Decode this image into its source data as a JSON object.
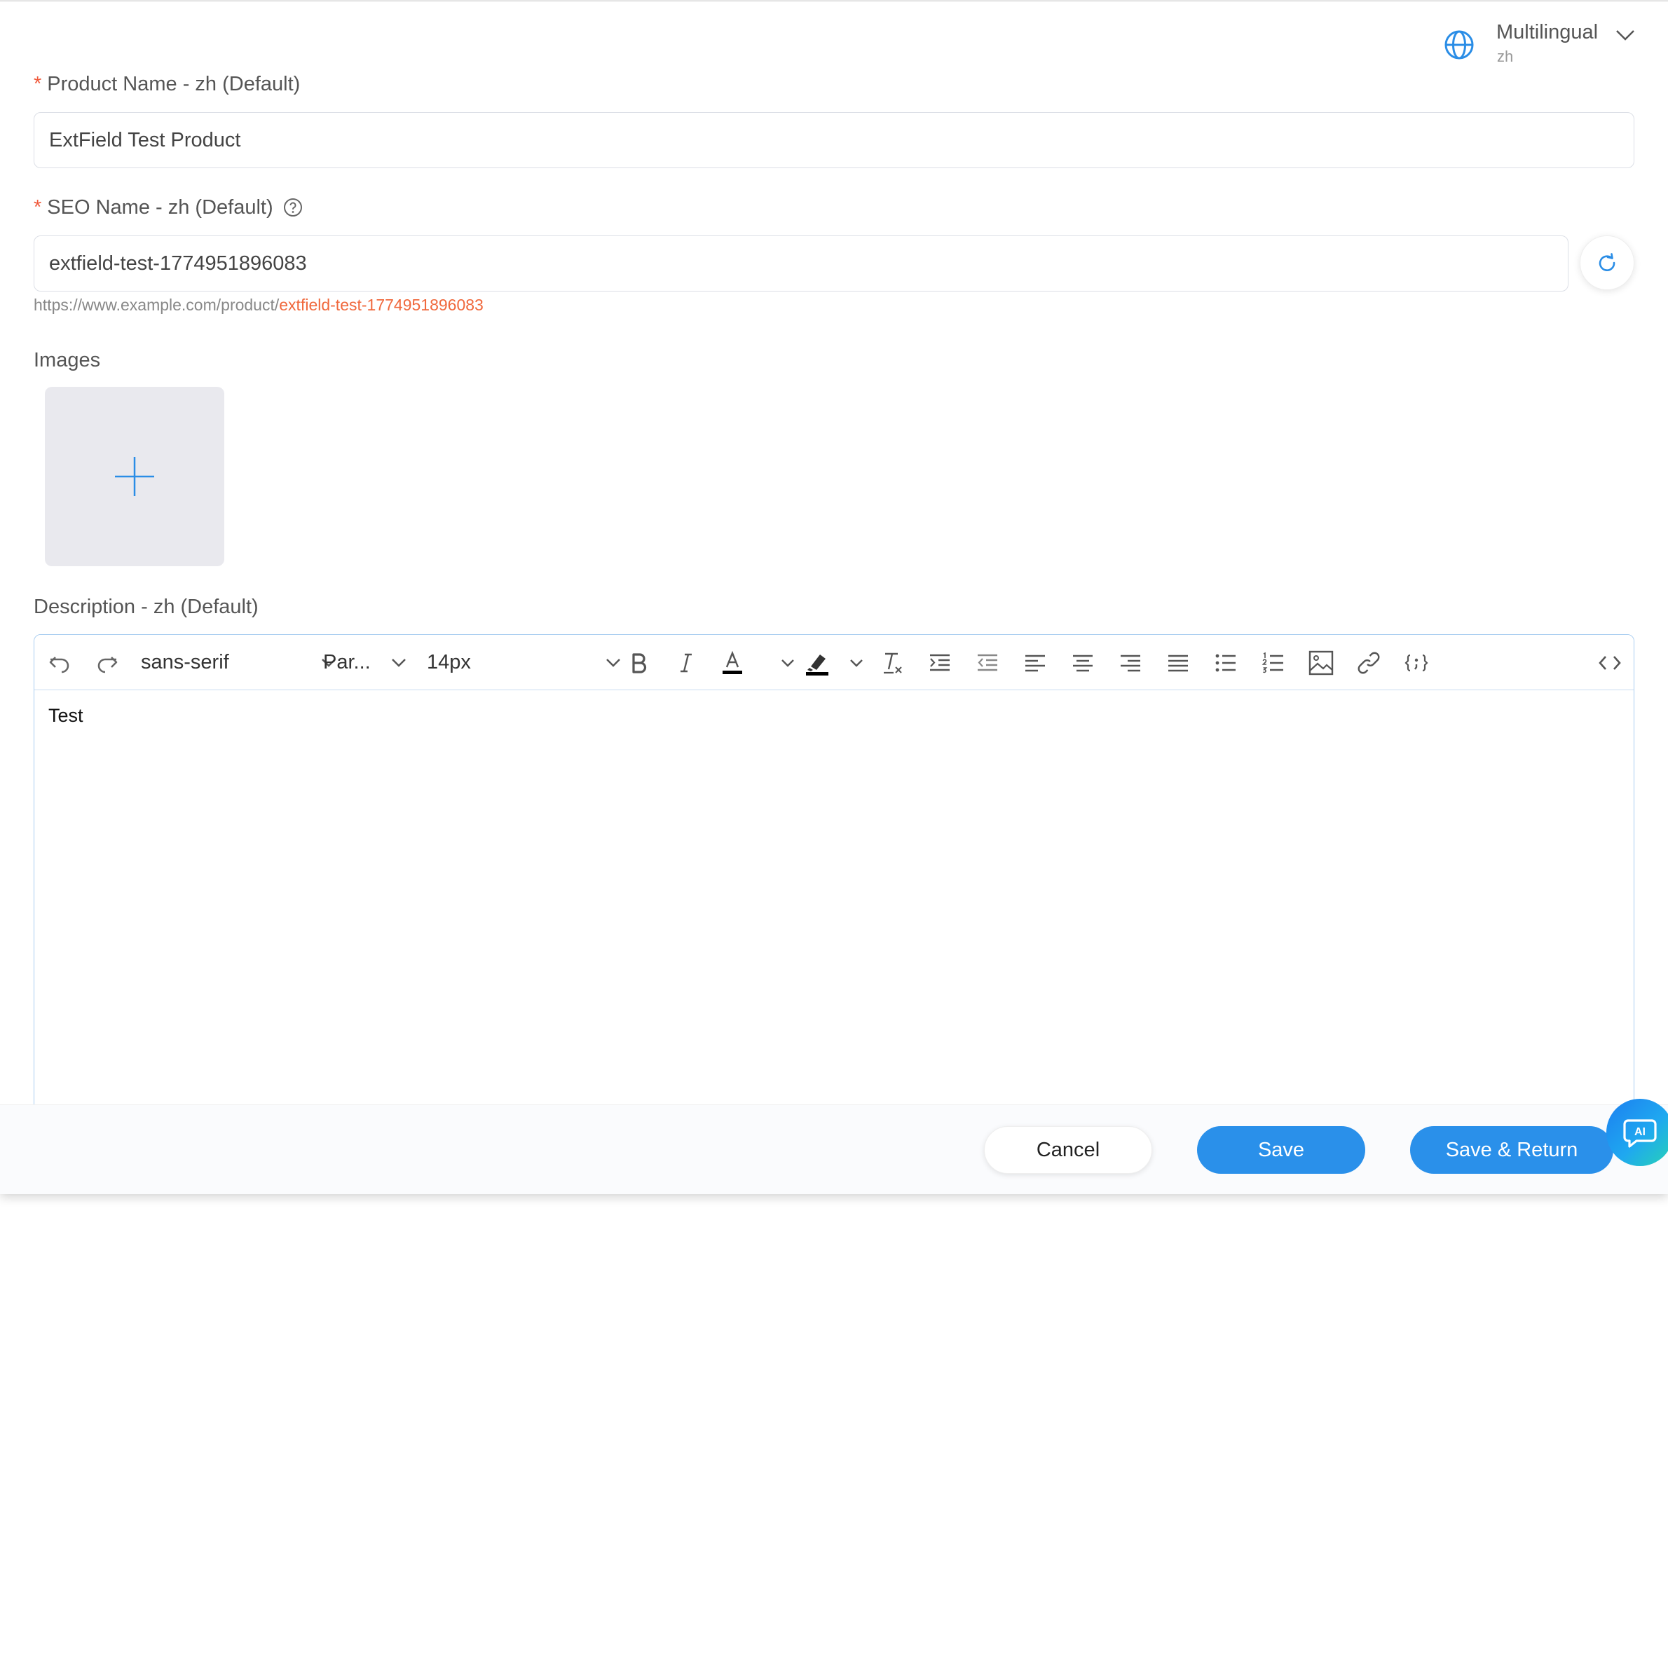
{
  "language": {
    "title": "Multilingual",
    "current": "zh"
  },
  "form": {
    "product_name": {
      "label": "Product Name - zh (Default)",
      "value": "ExtField Test Product"
    },
    "seo_name": {
      "label": "SEO Name - zh (Default)",
      "value": "extfield-test-1774951896083",
      "url_prefix": "https://www.example.com/product/",
      "url_slug": "extfield-test-1774951896083"
    },
    "images": {
      "label": "Images"
    },
    "description": {
      "label": "Description - zh (Default)",
      "content": "Test"
    }
  },
  "editor": {
    "font_family": "sans-serif",
    "block_format": "Par...",
    "font_size": "14px"
  },
  "footer": {
    "cancel_label": "Cancel",
    "save_label": "Save",
    "save_return_label": "Save & Return"
  },
  "ai": {
    "label": "AI"
  },
  "colors": {
    "primary": "#2a90ea",
    "required": "#f05a3c",
    "slug": "#f0683c",
    "editor_border": "#a8cdf0"
  },
  "icons": [
    "globe-icon",
    "chevron-down-icon",
    "help-circle-icon",
    "refresh-icon",
    "plus-icon",
    "undo-icon",
    "redo-icon",
    "bold-icon",
    "italic-icon",
    "font-color-icon",
    "highlight-icon",
    "clear-format-icon",
    "indent-icon",
    "outdent-icon",
    "align-left-icon",
    "align-center-icon",
    "align-right-icon",
    "align-justify-icon",
    "bullet-list-icon",
    "numbered-list-icon",
    "image-icon",
    "link-icon",
    "variable-icon",
    "source-code-icon",
    "ai-chat-icon"
  ]
}
